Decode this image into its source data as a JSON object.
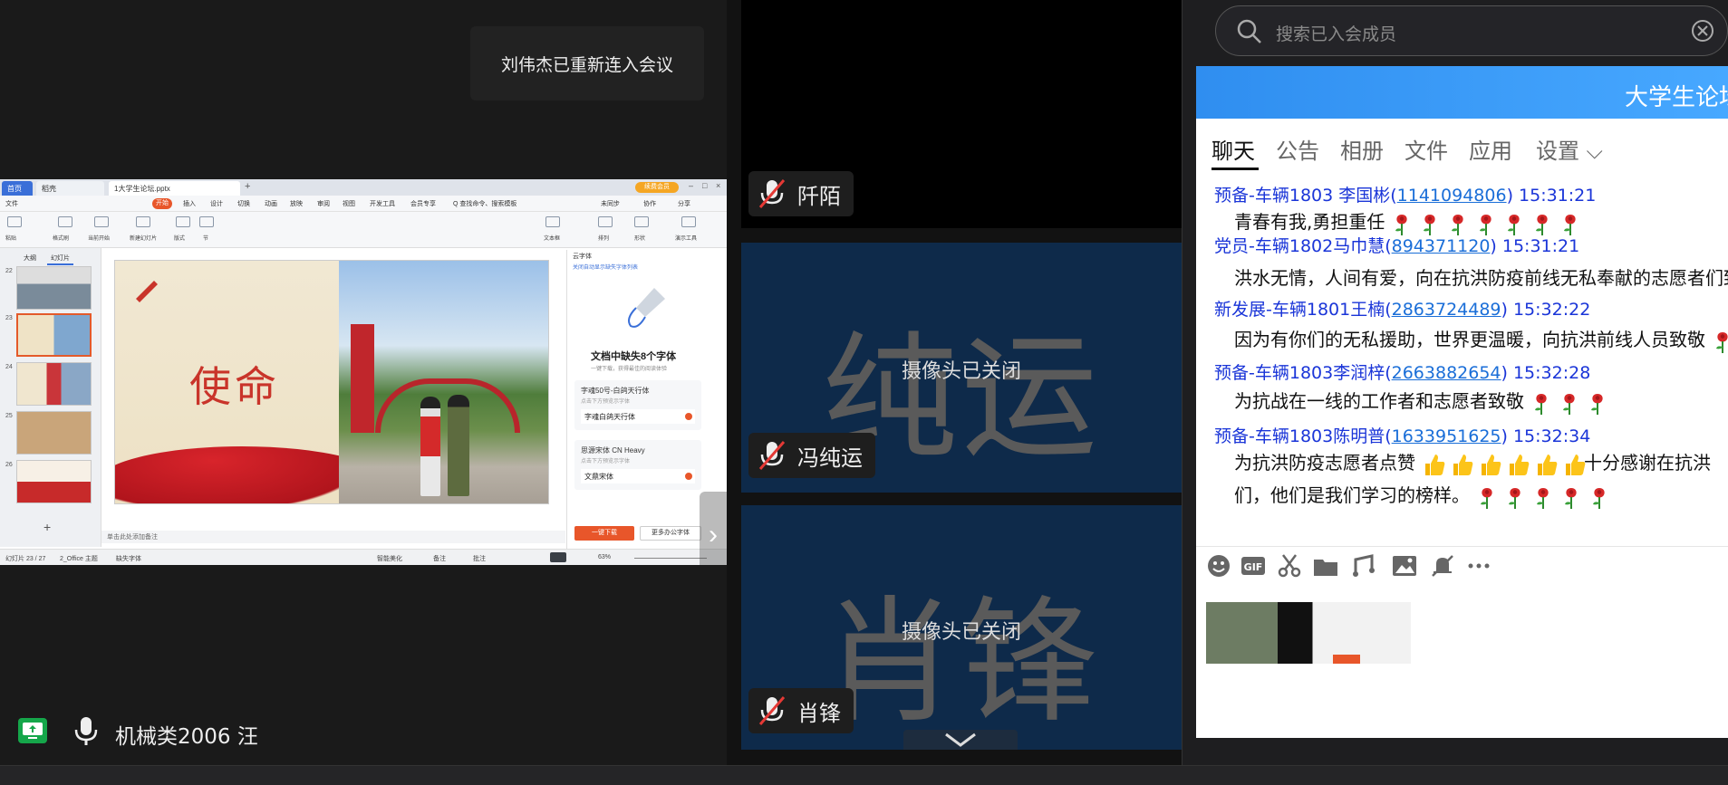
{
  "toast": {
    "text": "刘伟杰已重新连入会议"
  },
  "self": {
    "name": "机械类2006 汪"
  },
  "shared_screen": {
    "tabs": [
      "首页",
      "稻壳",
      "1大学生论坛.pptx"
    ],
    "vip_label": "续费会员",
    "menu": [
      "文件",
      "开始",
      "插入",
      "设计",
      "切换",
      "动画",
      "放映",
      "审阅",
      "视图",
      "开发工具",
      "会员专享",
      "Q 查找命令、搜索模板"
    ],
    "menu_right": [
      "未同步",
      "协作",
      "分享"
    ],
    "ribbon_labels": [
      "粘贴",
      "格式刷",
      "当前开始",
      "新建幻灯片",
      "版式",
      "节",
      "文本框",
      "排列",
      "形状",
      "演示工具"
    ],
    "left_panel_tabs": [
      "大纲",
      "幻灯片"
    ],
    "thumb_numbers": [
      "22",
      "23",
      "24",
      "25",
      "26"
    ],
    "slide_title": "使命",
    "right_panel": {
      "header": "云字体",
      "link": "关闭自动显示缺失字体列表",
      "title": "文档中缺失8个字体",
      "subtitle": "一键下载，获得最佳的阅读体验",
      "fonts": [
        {
          "name": "字魂50号-白鸽天行体",
          "tip": "点击下方预览示字体",
          "sample": "字魂白鸽天行体"
        },
        {
          "name": "思源宋体 CN Heavy",
          "tip": "点击下方预览示字体",
          "sample": "文鼎宋体"
        }
      ],
      "download_btn": "一键下载",
      "more_btn": "更多办公字体"
    },
    "notes": "单击此处添加备注",
    "status": [
      "幻灯片 23 / 27",
      "2_Office 主题",
      "缺失字体",
      "智能美化",
      "备注",
      "批注",
      "63%"
    ]
  },
  "participants": [
    {
      "name": "阡陌",
      "camera_off": "",
      "bg_name": ""
    },
    {
      "name": "冯纯运",
      "camera_off": "摄像头已关闭",
      "bg_name": "纯运"
    },
    {
      "name": "肖锋",
      "camera_off": "摄像头已关闭",
      "bg_name": "肖锋"
    }
  ],
  "search": {
    "placeholder": "搜索已入会成员"
  },
  "chat": {
    "group_title": "大学生论坛",
    "tabs": [
      "聊天",
      "公告",
      "相册",
      "文件",
      "应用",
      "设置 ⌵"
    ],
    "messages": [
      {
        "sender": "预备-车辆1803 李国彬(",
        "qq": "1141094806",
        "time": ")  15:31:21",
        "body": "青春有我,勇担重任",
        "emoji": "rose",
        "emoji_count": 7
      },
      {
        "sender": "党员-车辆1802马巾慧(",
        "qq": "894371120",
        "time": ")  15:31:21",
        "body": "洪水无情，人间有爱，向在抗洪防疫前线无私奉献的志愿者们致",
        "emoji": "",
        "emoji_count": 0
      },
      {
        "sender": "新发展-车辆1801王楠(",
        "qq": "2863724489",
        "time": ")  15:32:22",
        "body": "因为有你们的无私援助，世界更温暖，向抗洪前线人员致敬",
        "emoji": "rose",
        "emoji_count": 1
      },
      {
        "sender": "预备-车辆1803李润梓(",
        "qq": "2663882654",
        "time": ")  15:32:28",
        "body": "为抗战在一线的工作者和志愿者致敬",
        "emoji": "rose",
        "emoji_count": 3
      },
      {
        "sender": "预备-车辆1803陈明普(",
        "qq": "1633951625",
        "time": ")  15:32:34",
        "body": "为抗洪防疫志愿者点赞",
        "emoji": "thumb",
        "emoji_count": 6,
        "body_tail": "十分感谢在抗洪",
        "body2": "们，他们是我们学习的榜样。",
        "emoji2": "rose",
        "emoji2_count": 5
      }
    ],
    "toolbar": [
      "smile-icon",
      "gif-icon",
      "scissors-icon",
      "folder-icon",
      "music-icon",
      "image-icon",
      "bell-mute-icon",
      "more-icon"
    ],
    "accent": "#2f8ef0"
  }
}
